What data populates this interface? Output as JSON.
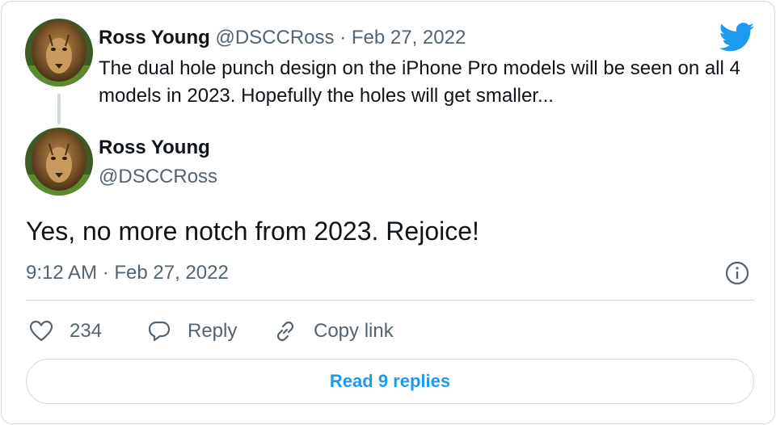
{
  "parent_tweet": {
    "author_name": "Ross Young",
    "author_handle": "@DSCCRoss",
    "separator": "·",
    "date": "Feb 27, 2022",
    "text": "The dual hole punch design on the iPhone Pro models will be seen on all 4 models in 2023. Hopefully the holes will get smaller..."
  },
  "main_tweet": {
    "author_name": "Ross Young",
    "author_handle": "@DSCCRoss",
    "text": "Yes, no more notch from 2023. Rejoice!",
    "timestamp": "9:12 AM · Feb 27, 2022"
  },
  "actions": {
    "like_count": "234",
    "reply_label": "Reply",
    "copy_link_label": "Copy link"
  },
  "read_replies_label": "Read 9 replies",
  "colors": {
    "accent": "#1d9bf0",
    "text": "#0f1419",
    "muted": "#536471",
    "border": "#cfd9de"
  },
  "icons": {
    "brand": "twitter-bird-icon",
    "info": "info-icon",
    "like": "heart-icon",
    "reply": "speech-bubble-icon",
    "copy": "link-icon"
  }
}
